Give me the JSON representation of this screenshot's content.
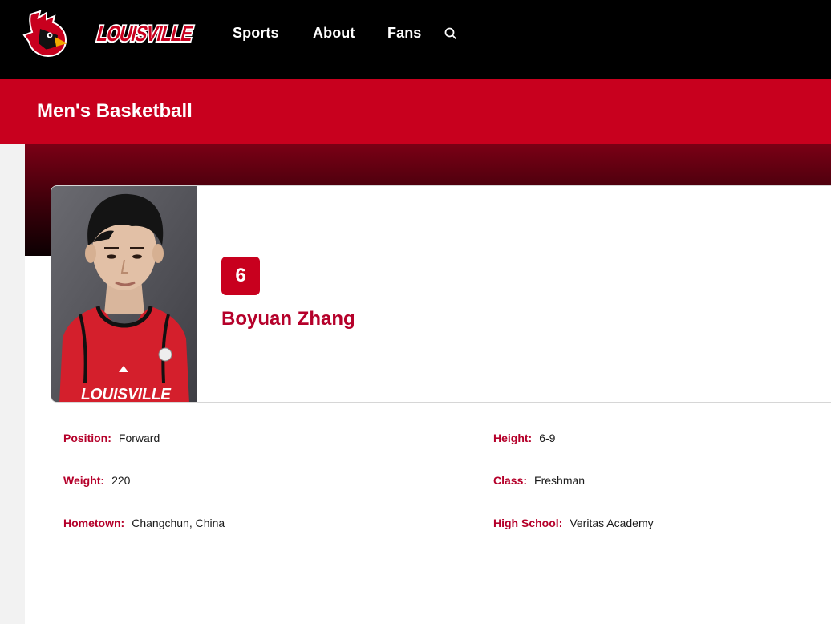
{
  "nav": {
    "brand": "LOUISVILLE",
    "items": [
      {
        "label": "Sports"
      },
      {
        "label": "About"
      },
      {
        "label": "Fans"
      }
    ],
    "search_icon": "search-icon"
  },
  "sport": {
    "title": "Men's Basketball"
  },
  "player": {
    "number": "6",
    "name": "Boyuan Zhang",
    "jersey_text": "LOUISVILLE"
  },
  "details": [
    {
      "label": "Position:",
      "value": "Forward"
    },
    {
      "label": "Height:",
      "value": "6-9"
    },
    {
      "label": "Weight:",
      "value": "220"
    },
    {
      "label": "Class:",
      "value": "Freshman"
    },
    {
      "label": "Hometown:",
      "value": "Changchun, China"
    },
    {
      "label": "High School:",
      "value": "Veritas Academy"
    }
  ],
  "colors": {
    "brand_red": "#c8001e",
    "label_red": "#b5002a",
    "nav_black": "#000000"
  }
}
